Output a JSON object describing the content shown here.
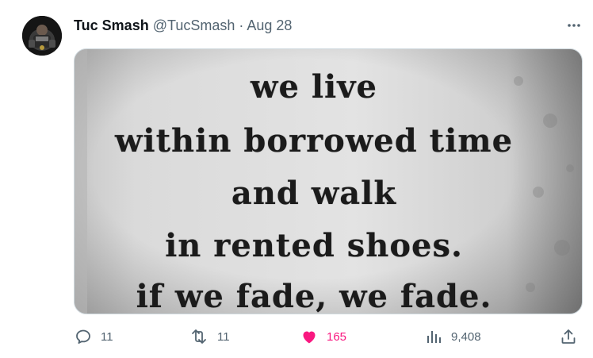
{
  "author": {
    "display_name": "Tuc Smash",
    "handle": "@TucSmash",
    "separator": "·",
    "date": "Aug 28"
  },
  "media": {
    "poem_lines": [
      "we live",
      "within borrowed time",
      "and walk",
      "in rented shoes.",
      "if we fade, we fade."
    ]
  },
  "actions": {
    "replies": "11",
    "retweets": "11",
    "likes": "165",
    "views": "9,408"
  },
  "colors": {
    "like_active": "#f91880",
    "muted": "#536471",
    "text": "#0f1419"
  },
  "icons": {
    "more": "more-dots-icon",
    "reply": "reply-icon",
    "retweet": "retweet-icon",
    "like": "heart-icon",
    "views": "views-bar-chart-icon",
    "share": "share-icon"
  }
}
